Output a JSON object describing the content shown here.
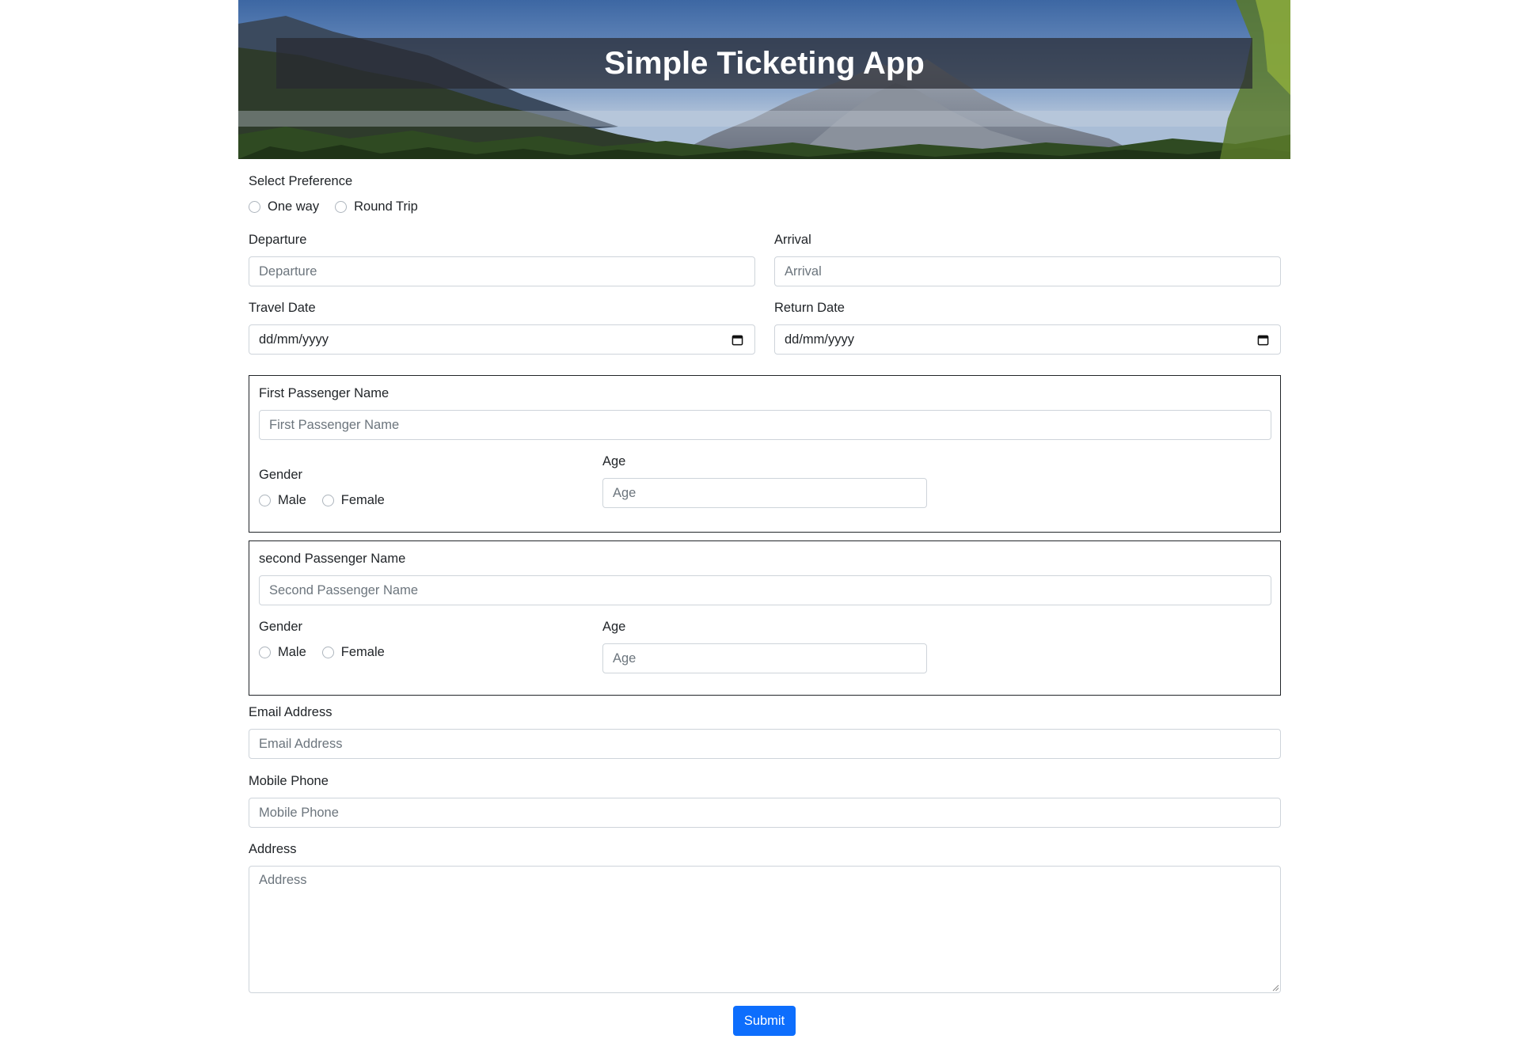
{
  "banner": {
    "title": "Simple Ticketing App"
  },
  "preference": {
    "label": "Select Preference",
    "options": [
      "One way",
      "Round Trip"
    ]
  },
  "departure": {
    "label": "Departure",
    "placeholder": "Departure"
  },
  "arrival": {
    "label": "Arrival",
    "placeholder": "Arrival"
  },
  "travel_date": {
    "label": "Travel Date",
    "value": "dd/mm/yyyy",
    "icon": "calendar-icon"
  },
  "return_date": {
    "label": "Return Date",
    "value": "dd/mm/yyyy",
    "icon": "calendar-icon"
  },
  "passenger1": {
    "name_label": "First Passenger Name",
    "name_placeholder": "First Passenger Name",
    "gender_label": "Gender",
    "gender_options": [
      "Male",
      "Female"
    ],
    "age_label": "Age",
    "age_placeholder": "Age"
  },
  "passenger2": {
    "name_label": "second Passenger Name",
    "name_placeholder": "Second Passenger Name",
    "gender_label": "Gender",
    "gender_options": [
      "Male",
      "Female"
    ],
    "age_label": "Age",
    "age_placeholder": "Age"
  },
  "email": {
    "label": "Email Address",
    "placeholder": "Email Address"
  },
  "phone": {
    "label": "Mobile Phone",
    "placeholder": "Mobile Phone"
  },
  "address": {
    "label": "Address",
    "placeholder": "Address"
  },
  "submit": {
    "label": "Submit"
  },
  "colors": {
    "primary": "#0d6efd",
    "border": "#ced4da",
    "text": "#212529",
    "placeholder": "#6c757d"
  }
}
